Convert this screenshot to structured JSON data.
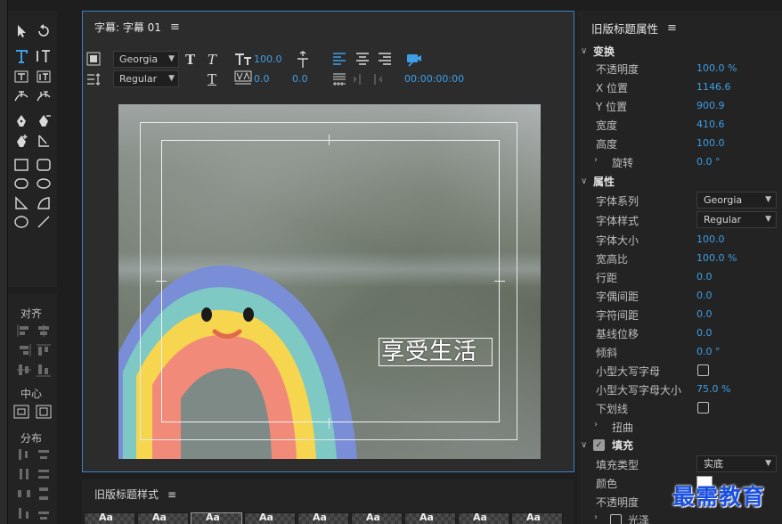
{
  "title_window": {
    "title": "字幕: 字幕 01",
    "toolbar": {
      "font_family": "Georgia",
      "font_style": "Regular",
      "font_size": "100.0",
      "kerning": "0.0",
      "leading": "0.0",
      "timecode": "00:00:00:00"
    },
    "caption_text": "享受生活"
  },
  "align_panel": {
    "align_label": "对齐",
    "center_label": "中心",
    "distribute_label": "分布"
  },
  "styles_panel": {
    "title": "旧版标题样式",
    "swatch_glyph": "Aa"
  },
  "properties": {
    "title": "旧版标题属性",
    "transform": {
      "label": "变换",
      "rows": [
        {
          "label": "不透明度",
          "value": "100.0 %"
        },
        {
          "label": "X 位置",
          "value": "1146.6"
        },
        {
          "label": "Y 位置",
          "value": "900.9"
        },
        {
          "label": "宽度",
          "value": "410.6"
        },
        {
          "label": "高度",
          "value": "100.0"
        }
      ],
      "rotation": {
        "label": "旋转",
        "value": "0.0 °"
      }
    },
    "attributes": {
      "label": "属性",
      "font_family": {
        "label": "字体系列",
        "value": "Georgia"
      },
      "font_style": {
        "label": "字体样式",
        "value": "Regular"
      },
      "rows": [
        {
          "label": "字体大小",
          "value": "100.0"
        },
        {
          "label": "宽高比",
          "value": "100.0 %"
        },
        {
          "label": "行距",
          "value": "0.0"
        },
        {
          "label": "字偶间距",
          "value": "0.0"
        },
        {
          "label": "字符间距",
          "value": "0.0"
        },
        {
          "label": "基线位移",
          "value": "0.0"
        },
        {
          "label": "倾斜",
          "value": "0.0 °"
        }
      ],
      "small_caps": {
        "label": "小型大写字母"
      },
      "small_caps_size": {
        "label": "小型大写字母大小",
        "value": "75.0 %"
      },
      "underline": {
        "label": "下划线"
      },
      "distort": {
        "label": "扭曲"
      }
    },
    "fill": {
      "label": "填充",
      "fill_type": {
        "label": "填充类型",
        "value": "实底"
      },
      "color": {
        "label": "颜色",
        "value": "#ffffff"
      },
      "opacity": {
        "label": "不透明度"
      },
      "gloss": {
        "label": "光泽"
      }
    }
  },
  "watermark": "最需教育",
  "colors": {
    "accent": "#3e9ee6",
    "panel": "#232323",
    "border_active": "#3d7fc4"
  }
}
